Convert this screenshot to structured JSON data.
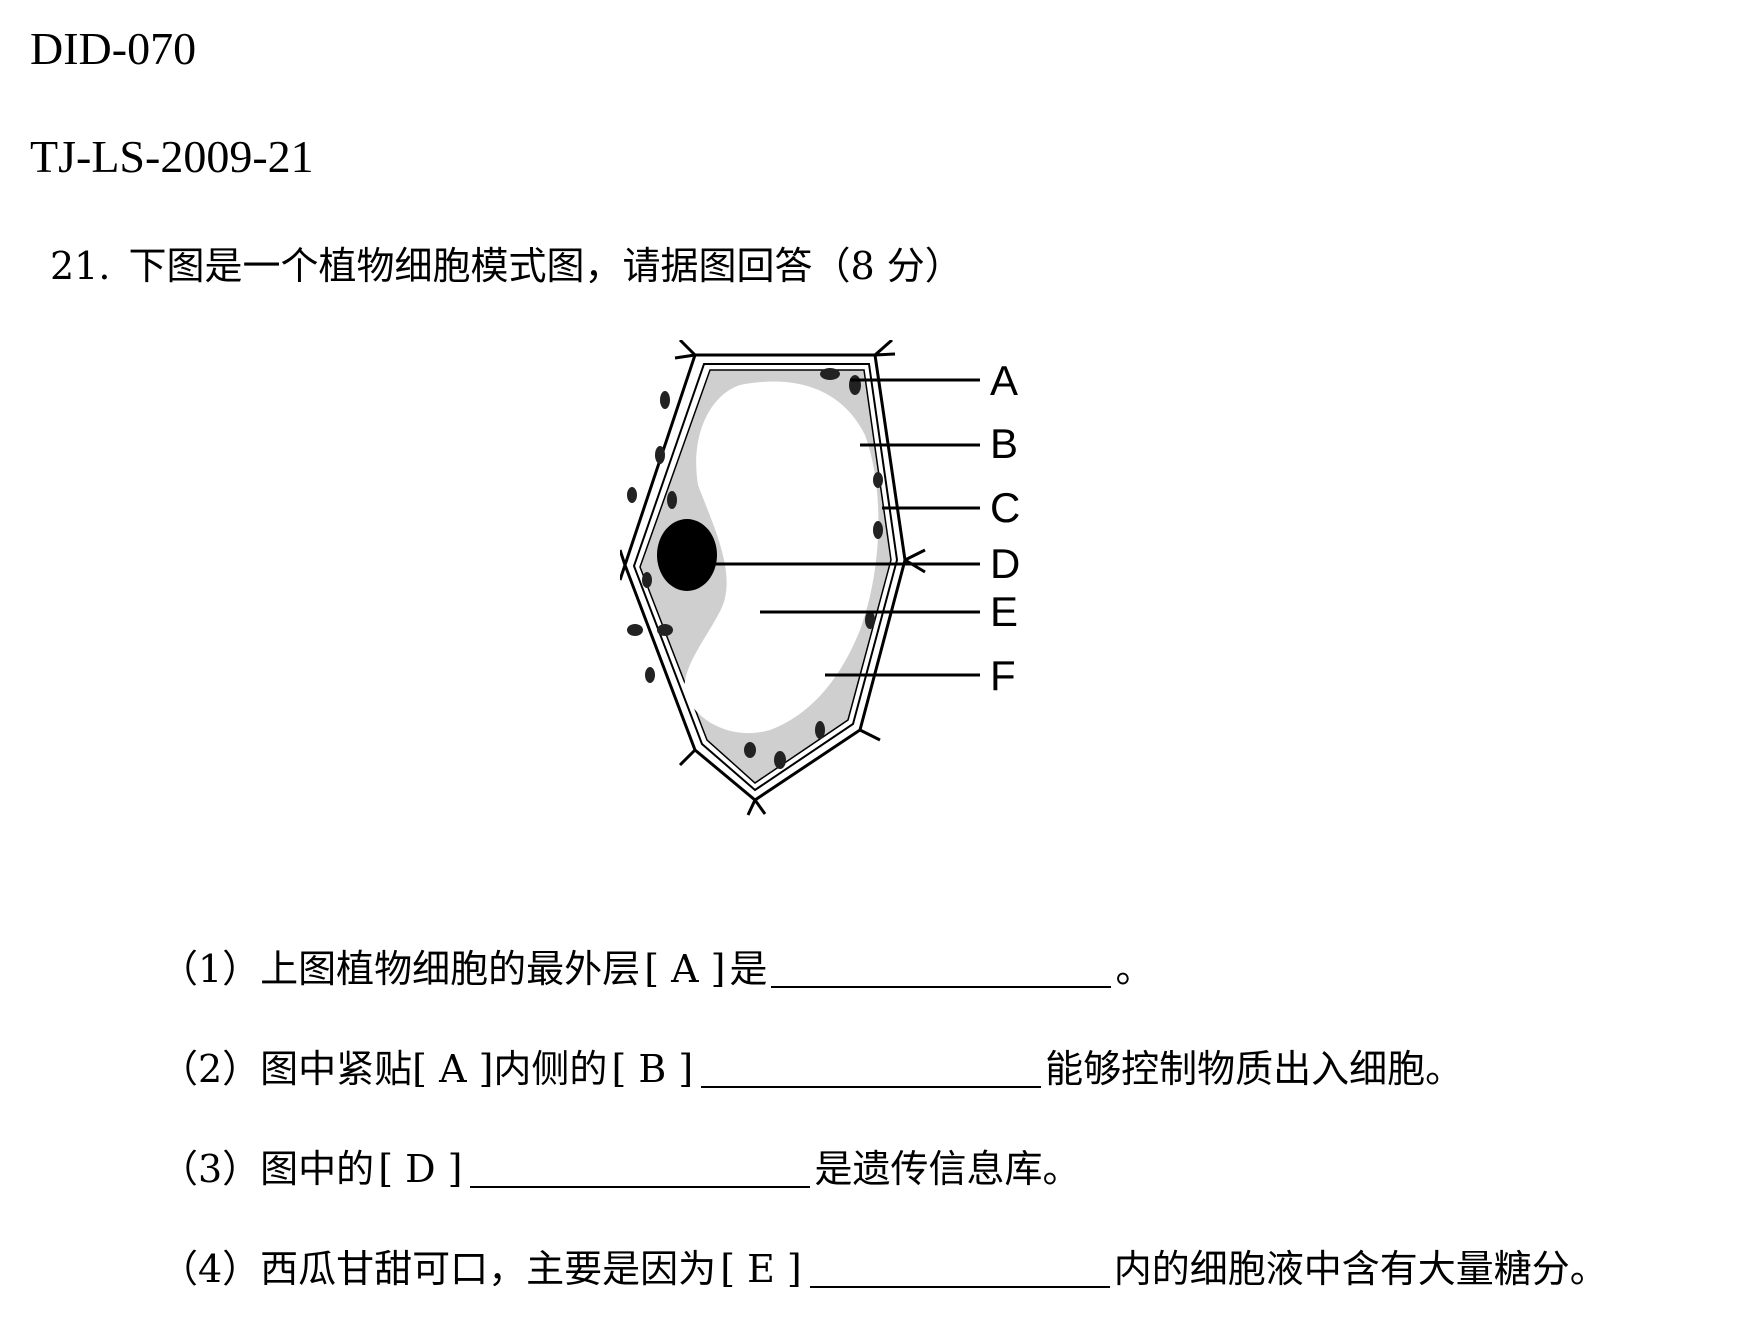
{
  "header": {
    "doc_id": "DID-070",
    "source_id": "TJ-LS-2009-21"
  },
  "question": {
    "number": "21.",
    "stem": "下图是一个植物细胞模式图，请据图回答（8 分）"
  },
  "figure": {
    "labels": [
      "A",
      "B",
      "C",
      "D",
      "E",
      "F"
    ]
  },
  "sub_questions": [
    {
      "prefix": "（1）上图植物细胞的最外层",
      "bracket": "[ A ]",
      "mid": "是",
      "suffix": "。"
    },
    {
      "prefix": "（2）图中紧贴[ A ]内侧的",
      "bracket": "[ B ]",
      "mid": "",
      "suffix": "能够控制物质出入细胞。"
    },
    {
      "prefix": "（3）图中的",
      "bracket": "[ D ]",
      "mid": "",
      "suffix": "是遗传信息库。"
    },
    {
      "prefix": "（4）西瓜甘甜可口，主要是因为",
      "bracket": "[ E ]",
      "mid": "",
      "suffix": "内的细胞液中含有大量糖分。"
    }
  ]
}
